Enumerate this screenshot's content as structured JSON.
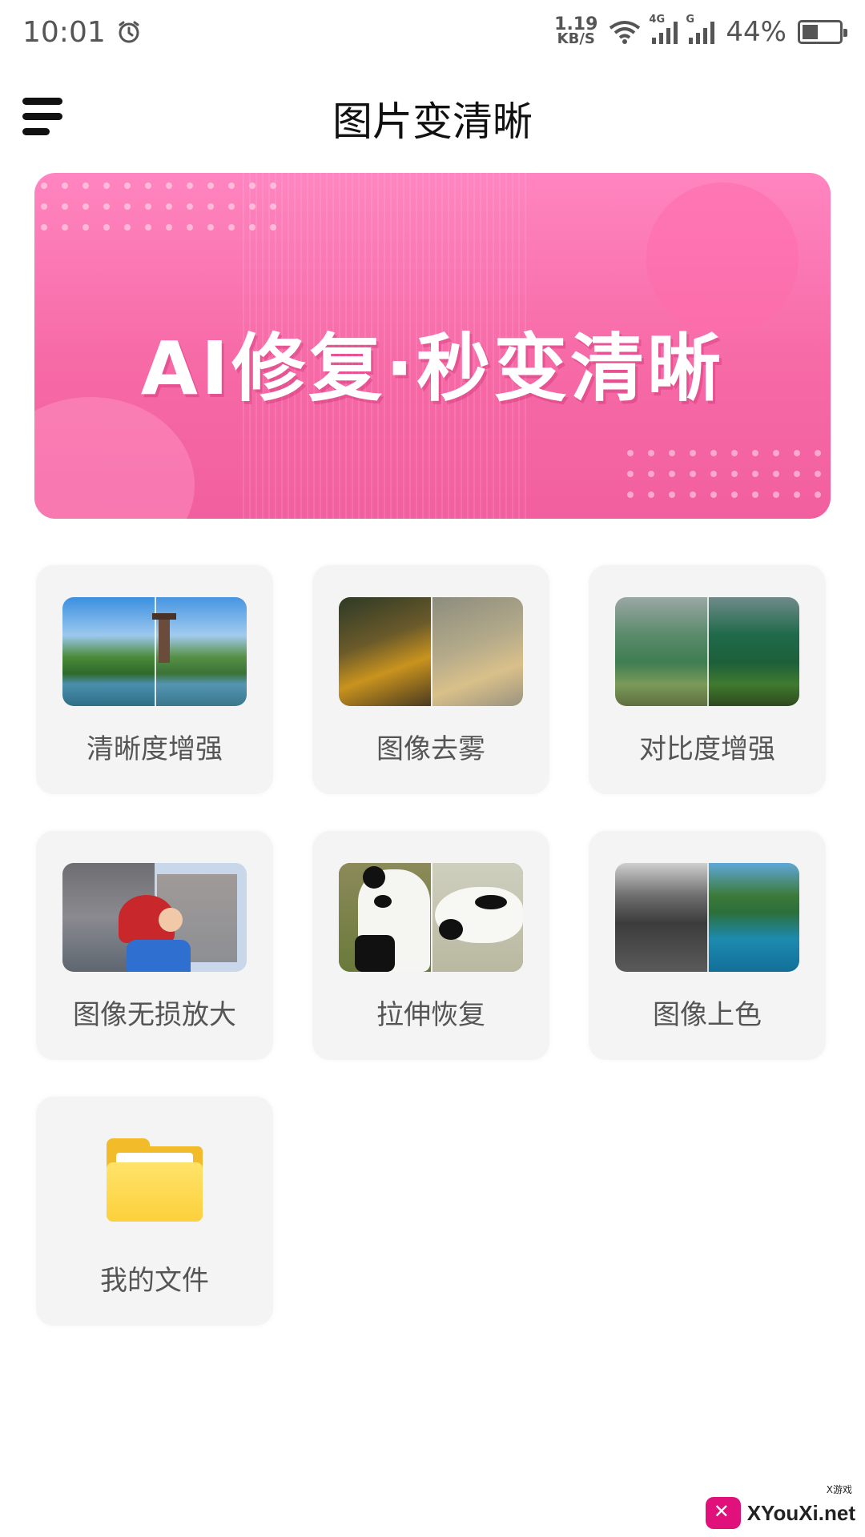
{
  "status_bar": {
    "time": "10:01",
    "alarm_icon": "alarm-clock-icon",
    "net_speed_value": "1.19",
    "net_speed_unit": "KB/S",
    "signal_1_tag": "4G",
    "signal_2_tag": "G",
    "battery": "44%",
    "battery_level": 0.44
  },
  "header": {
    "menu_icon": "hamburger-menu-icon",
    "title": "图片变清晰"
  },
  "banner": {
    "slogan": "AI修复·秒变清晰",
    "colors": {
      "top": "#ff85c0",
      "bottom": "#f25f9f"
    }
  },
  "features": [
    {
      "label": "清晰度增强",
      "icon": "enhance-clarity-thumbnail"
    },
    {
      "label": "图像去雾",
      "icon": "defog-thumbnail"
    },
    {
      "label": "对比度增强",
      "icon": "contrast-thumbnail"
    },
    {
      "label": "图像无损放大",
      "icon": "upscale-thumbnail"
    },
    {
      "label": "拉伸恢复",
      "icon": "stretch-restore-thumbnail"
    },
    {
      "label": "图像上色",
      "icon": "colorize-thumbnail"
    },
    {
      "label": "我的文件",
      "icon": "folder-icon"
    }
  ],
  "watermark": {
    "text": "XYouXi.net",
    "small_text": "X游戏"
  }
}
